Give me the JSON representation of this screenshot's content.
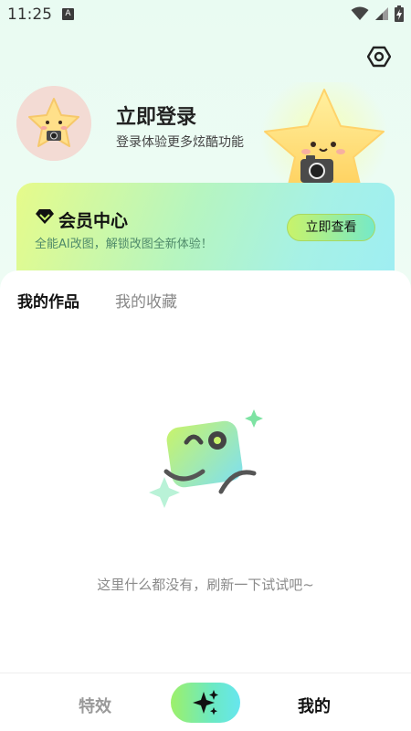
{
  "status_bar": {
    "time": "11:25",
    "app_indicator": "A",
    "icons": [
      "wifi-icon",
      "signal-icon",
      "battery-charging-icon"
    ]
  },
  "header": {
    "settings_icon": "settings-icon"
  },
  "profile": {
    "login_title": "立即登录",
    "login_subtitle": "登录体验更多炫酷功能"
  },
  "vip_card": {
    "title": "会员中心",
    "subtitle": "全能AI改图，解锁改图全新体验！",
    "button_label": "立即查看",
    "icon": "diamond-icon"
  },
  "tabs": [
    {
      "label": "我的作品",
      "active": true
    },
    {
      "label": "我的收藏",
      "active": false
    }
  ],
  "empty_state": {
    "message": "这里什么都没有，刷新一下试试吧~"
  },
  "bottom_nav": {
    "effects_label": "特效",
    "create_icon": "sparkle-icon",
    "mine_label": "我的",
    "active": "mine"
  },
  "colors": {
    "accent_green": "#9df06a",
    "accent_cyan": "#67e6ef",
    "vip_sub_text": "#4f8a6a"
  }
}
